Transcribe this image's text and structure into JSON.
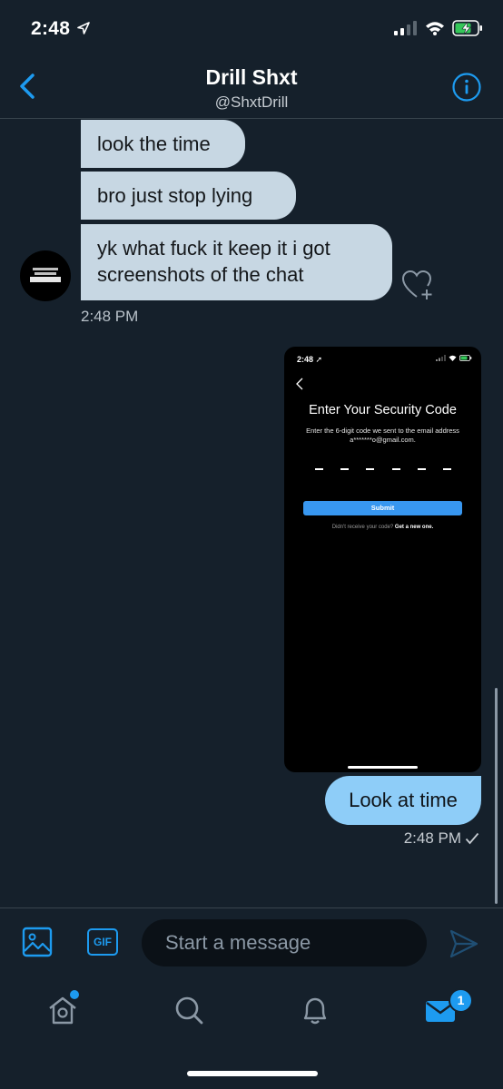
{
  "status_bar": {
    "time": "2:48"
  },
  "header": {
    "title": "Drill Shxt",
    "handle": "@ShxtDrill"
  },
  "messages_in": [
    {
      "text": "look the time"
    },
    {
      "text": "bro just stop lying"
    },
    {
      "text": "yk what fuck it keep it i got screenshots of the chat"
    }
  ],
  "messages_in_time": "2:48 PM",
  "screenshot": {
    "time": "2:48",
    "title": "Enter Your Security Code",
    "description": "Enter the 6-digit code we sent to the email address a*******o@gmail.com.",
    "submit_label": "Submit",
    "resend_prefix": "Didn't receive your code?",
    "resend_link": "Get a new one."
  },
  "message_out": {
    "text": "Look at time",
    "time": "2:48 PM"
  },
  "composer": {
    "placeholder": "Start a message",
    "gif_label": "GIF"
  },
  "tabbar": {
    "messages_badge": "1"
  },
  "colors": {
    "background": "#15202b",
    "accent": "#1d9bf0",
    "bubble_in": "#c7d7e3",
    "bubble_out": "#8ecdf8"
  }
}
